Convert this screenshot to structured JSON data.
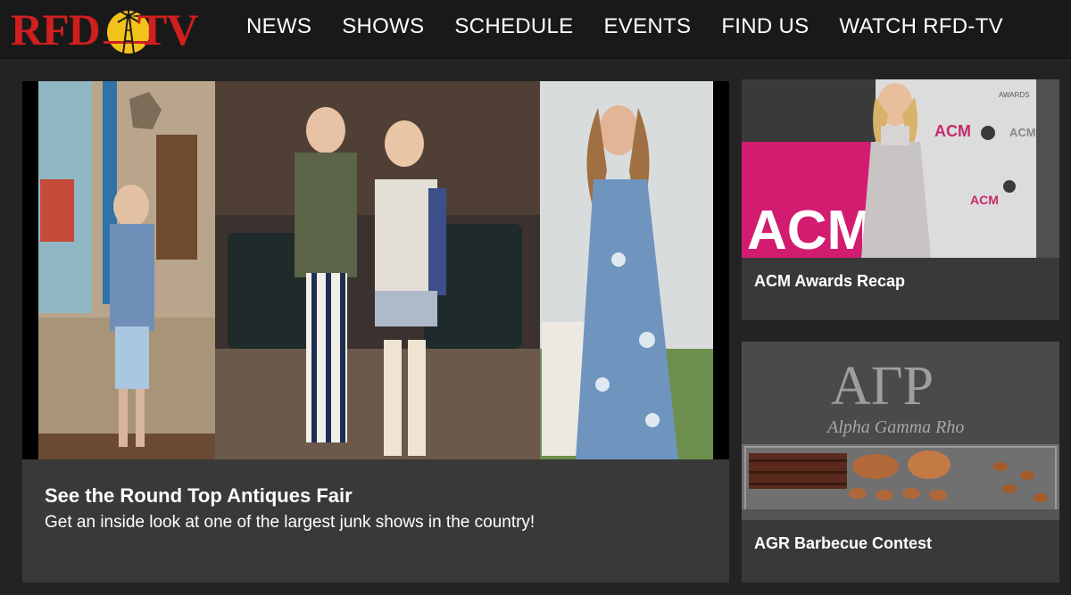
{
  "brand": {
    "logo_text_left": "RFD",
    "logo_text_right": "TV",
    "logo_color": "#cf1f1f"
  },
  "nav": {
    "items": [
      {
        "label": "NEWS"
      },
      {
        "label": "SHOWS"
      },
      {
        "label": "SCHEDULE"
      },
      {
        "label": "EVENTS"
      },
      {
        "label": "FIND US"
      },
      {
        "label": "WATCH RFD-TV"
      }
    ]
  },
  "featured": {
    "title": "See the Round Top Antiques Fair",
    "subtitle": "Get an inside look at one of the largest junk shows in the country!"
  },
  "side_stories": [
    {
      "title": "ACM Awards Recap",
      "image_text_1": "ACM",
      "image_text_2": "AWARDS"
    },
    {
      "title": "AGR Barbecue Contest",
      "image_text_1": "ΑΓΡ",
      "image_text_2": "Alpha Gamma Rho"
    }
  ]
}
